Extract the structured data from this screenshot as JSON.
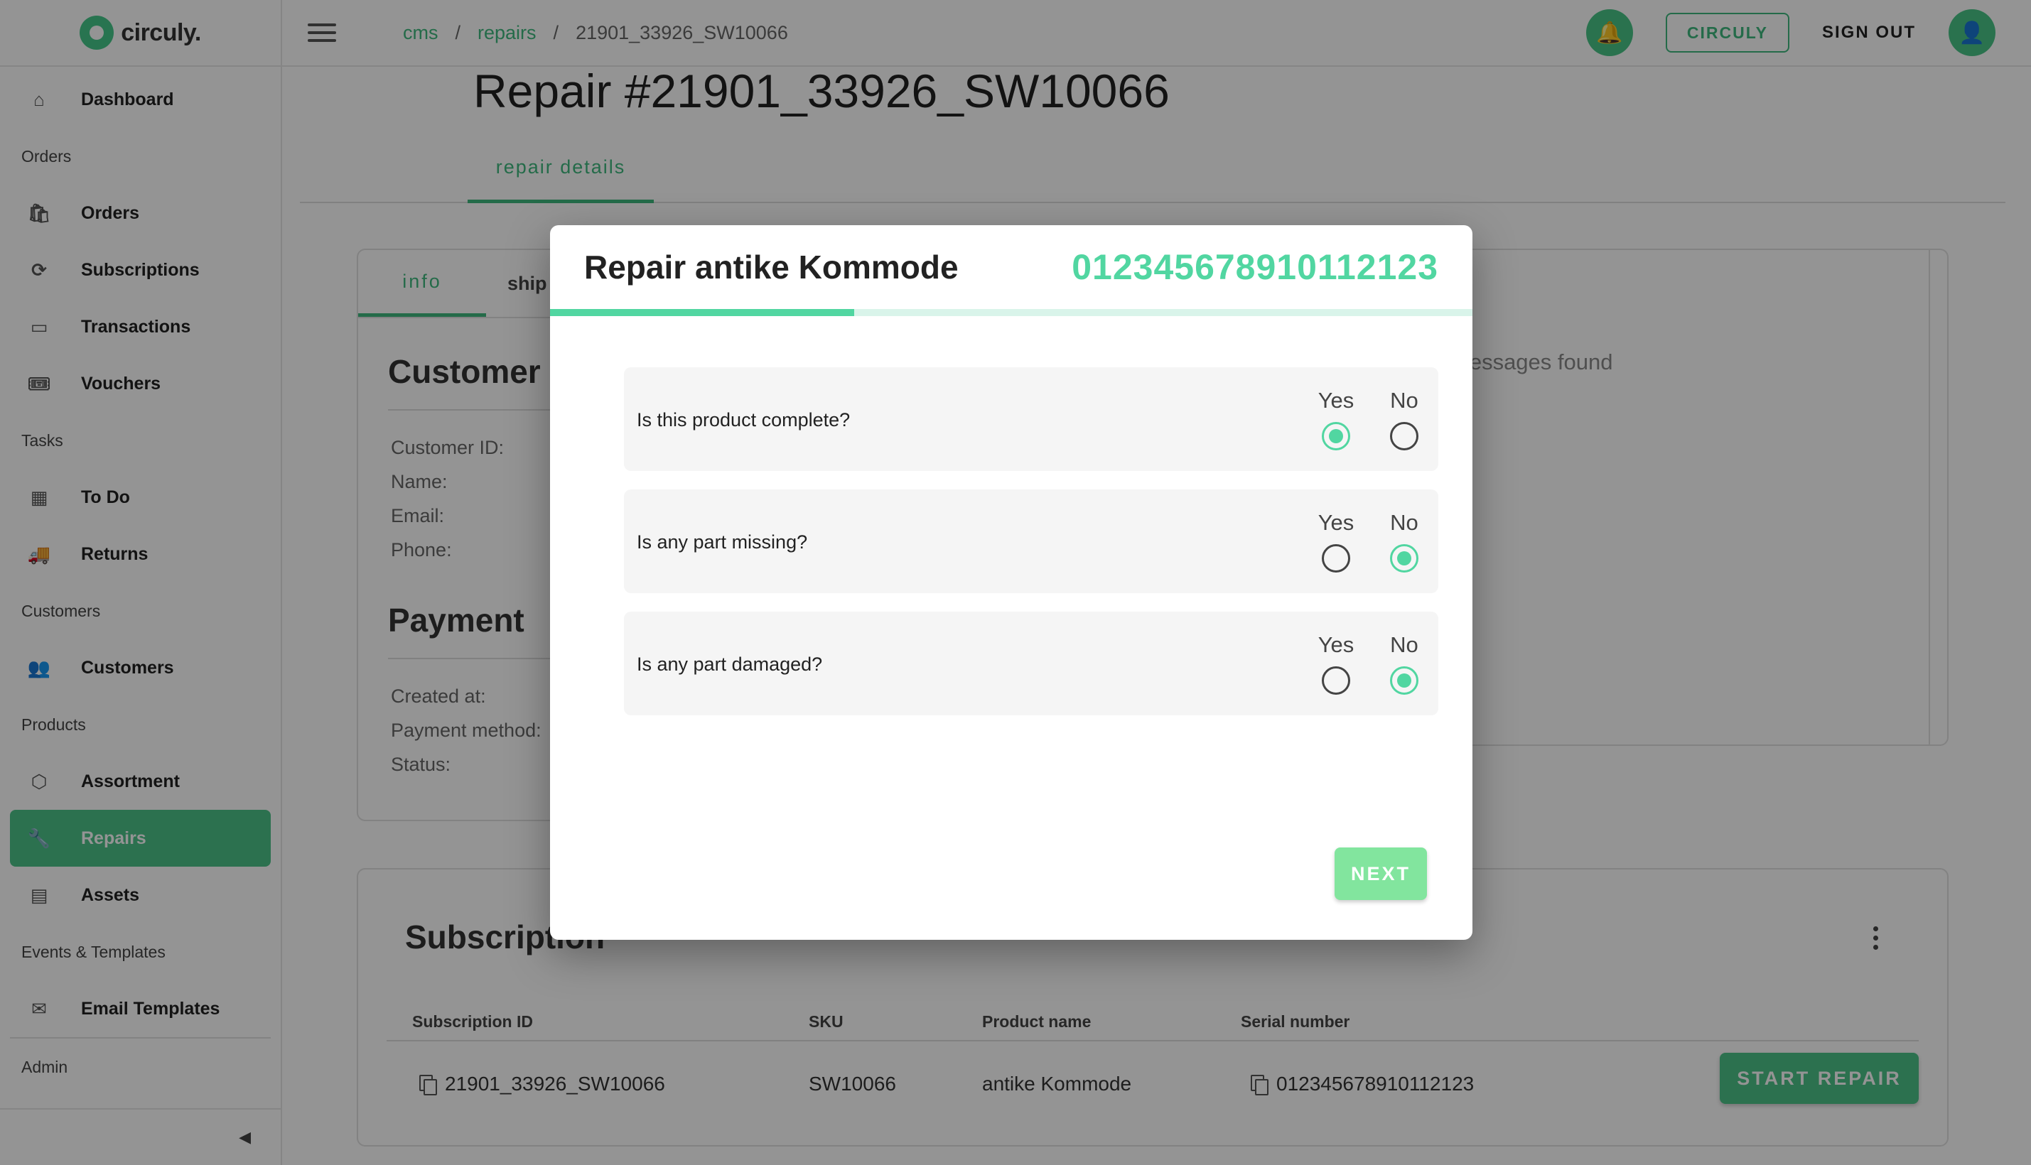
{
  "app": {
    "logo_text": "circuly."
  },
  "topbar": {
    "breadcrumbs": [
      "cms",
      "repairs",
      "21901_33926_SW10066"
    ],
    "circuly_label": "CIRCULY",
    "signout_label": "SIGN OUT"
  },
  "sidebar": {
    "items": [
      {
        "type": "item",
        "label": "Dashboard",
        "icon": "home-icon"
      },
      {
        "type": "section",
        "label": "Orders"
      },
      {
        "type": "item",
        "label": "Orders",
        "icon": "shopping-bag-icon"
      },
      {
        "type": "item",
        "label": "Subscriptions",
        "icon": "sync-icon"
      },
      {
        "type": "item",
        "label": "Transactions",
        "icon": "credit-card-icon"
      },
      {
        "type": "item",
        "label": "Vouchers",
        "icon": "voucher-icon"
      },
      {
        "type": "section",
        "label": "Tasks"
      },
      {
        "type": "item",
        "label": "To Do",
        "icon": "board-icon"
      },
      {
        "type": "item",
        "label": "Returns",
        "icon": "truck-icon"
      },
      {
        "type": "section",
        "label": "Customers"
      },
      {
        "type": "item",
        "label": "Customers",
        "icon": "people-icon"
      },
      {
        "type": "section",
        "label": "Products"
      },
      {
        "type": "item",
        "label": "Assortment",
        "icon": "box-icon"
      },
      {
        "type": "item",
        "label": "Repairs",
        "icon": "wrench-icon",
        "active": true
      },
      {
        "type": "item",
        "label": "Assets",
        "icon": "store-icon"
      },
      {
        "type": "section",
        "label": "Events & Templates"
      },
      {
        "type": "item",
        "label": "Email Templates",
        "icon": "mail-icon"
      },
      {
        "type": "section",
        "label": "Admin"
      }
    ]
  },
  "page": {
    "title": "Repair #21901_33926_SW10066",
    "tab_label": "repair details",
    "info_tabs": [
      "info",
      "ship"
    ],
    "customer_title": "Customer",
    "customer_fields": [
      "Customer ID:",
      "Name:",
      "Email:",
      "Phone:"
    ],
    "payment_title": "Payment",
    "payment_fields": [
      "Created at:",
      "Payment method:",
      "Status:"
    ],
    "messages_text": "messages found"
  },
  "subscription": {
    "title": "Subscription",
    "columns": [
      "Subscription ID",
      "SKU",
      "Product name",
      "Serial number"
    ],
    "row": {
      "subscription_id": "21901_33926_SW10066",
      "sku": "SW10066",
      "product_name": "antike Kommode",
      "serial_number": "012345678910112123"
    },
    "start_repair_label": "START REPAIR"
  },
  "dialog": {
    "title": "Repair antike Kommode",
    "serial": "012345678910112123",
    "progress_fraction": 0.33,
    "yes_label": "Yes",
    "no_label": "No",
    "questions": [
      {
        "text": "Is this product complete?",
        "answer": "yes"
      },
      {
        "text": "Is any part missing?",
        "answer": "no"
      },
      {
        "text": "Is any part damaged?",
        "answer": "no"
      }
    ],
    "next_label": "NEXT"
  },
  "colors": {
    "accent": "#51d6a1",
    "primary": "#4cc389"
  }
}
